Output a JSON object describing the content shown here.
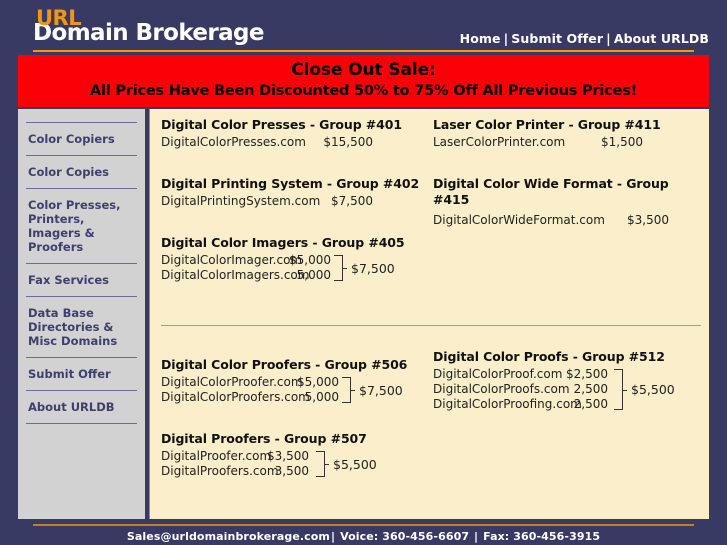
{
  "header": {
    "logo_top": "URL",
    "logo_main": "Domain Brokerage",
    "nav": [
      {
        "label": "Home"
      },
      {
        "label": "Submit Offer"
      },
      {
        "label": "About URLDB"
      }
    ],
    "nav_separator": "|"
  },
  "banner": {
    "line1": "Close Out Sale:",
    "line2": "All Prices Have Been Discounted 50% to 75% Off All Previous Prices!",
    "background_color": "#fb0007",
    "text_color": "#000000"
  },
  "sidebar": {
    "items": [
      {
        "label": "Color Copiers"
      },
      {
        "label": "Color Copies"
      },
      {
        "label": "Color Presses, Printers, Imagers & Proofers"
      },
      {
        "label": "Fax Services"
      },
      {
        "label": "Data Base Directories & Misc Domains"
      },
      {
        "label": "Submit Offer"
      },
      {
        "label": "About URLDB"
      }
    ],
    "background_color": "#d2d2d2",
    "text_color": "#3d3f6e"
  },
  "listings": {
    "top_left": [
      {
        "title": "Digital Color Presses - Group #401",
        "rows": [
          {
            "domain": "DigitalColorPresses.com",
            "price": "$15,500"
          }
        ],
        "total": null
      },
      {
        "title": "Digital Printing System - Group #402",
        "rows": [
          {
            "domain": "DigitalPrintingSystem.com",
            "price": "$7,500"
          }
        ],
        "total": null
      },
      {
        "title": "Digital Color Imagers - Group #405",
        "rows": [
          {
            "domain": "DigitalColorImager.com",
            "price": "$5,000"
          },
          {
            "domain": "DigitalColorImagers.com",
            "price": "5,000"
          }
        ],
        "total": "$7,500"
      }
    ],
    "top_right": [
      {
        "title": "Laser Color Printer - Group #411",
        "rows": [
          {
            "domain": "LaserColorPrinter.com",
            "price": "$1,500"
          }
        ],
        "total": null
      },
      {
        "title": "Digital Color Wide Format - Group #415",
        "rows": [
          {
            "domain": "DigitalColorWideFormat.com",
            "price": "$3,500"
          }
        ],
        "total": null
      }
    ],
    "bottom_left": [
      {
        "title": "Digital Color Proofers - Group #506",
        "rows": [
          {
            "domain": "DigitalColorProofer.com",
            "price": "$5,000"
          },
          {
            "domain": "DigitalColorProofers.com",
            "price": "5,000"
          }
        ],
        "total": "$7,500"
      },
      {
        "title": "Digital Proofers - Group #507",
        "rows": [
          {
            "domain": "DigitalProofer.com",
            "price": "$3,500"
          },
          {
            "domain": "DigitalProofers.com",
            "price": "3,500"
          }
        ],
        "total": "$5,500"
      }
    ],
    "bottom_right": [
      {
        "title": "Digital Color Proofs - Group #512",
        "rows": [
          {
            "domain": "DigitalColorProof.com",
            "price": "$2,500"
          },
          {
            "domain": "DigitalColorProofs.com",
            "price": "2,500"
          },
          {
            "domain": "DigitalColorProofing.com",
            "price": "2,500"
          }
        ],
        "total": "$5,500"
      }
    ]
  },
  "footer": {
    "email": "Sales@urldomainbrokerage.com",
    "voice": "Voice: 360-456-6607",
    "fax": "Fax: 360-456-3915",
    "separator": "|"
  },
  "colors": {
    "page_background": "#393a63",
    "content_background": "#faeecb",
    "accent_orange": "#f2960f",
    "sale_red": "#fb0007"
  }
}
